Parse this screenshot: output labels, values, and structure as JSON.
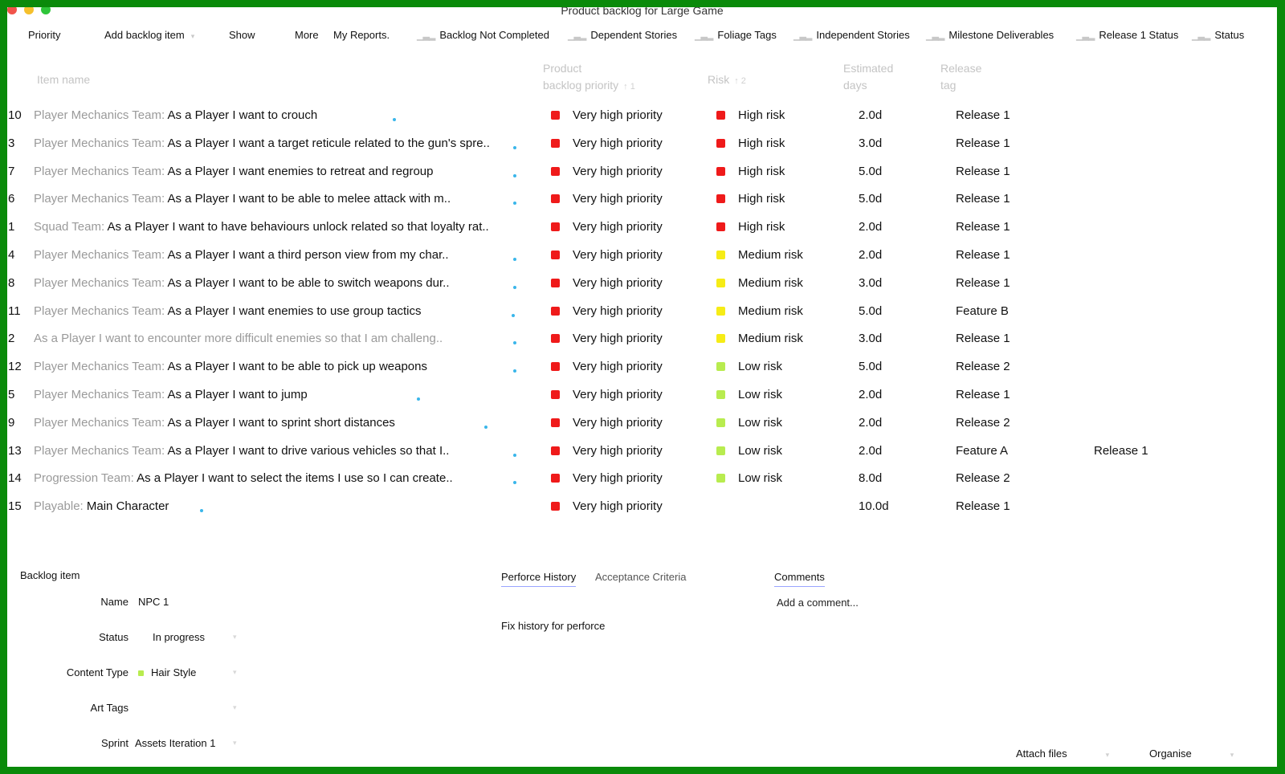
{
  "window": {
    "title": "Product backlog for Large Game"
  },
  "toolbar": {
    "priority": "Priority",
    "add_backlog_item": "Add backlog item",
    "show": "Show",
    "more": "More",
    "my_reports": "My Reports.",
    "reports": [
      "Backlog Not Completed",
      "Dependent Stories",
      "Foliage Tags",
      "Independent Stories",
      "Milestone Deliverables",
      "Release 1 Status",
      "Status"
    ]
  },
  "columns": {
    "item_name": "Item name",
    "priority_l1": "Product",
    "priority_l2": "backlog priority",
    "priority_sort": "↑ 1",
    "risk": "Risk",
    "risk_sort": "↑ 2",
    "est_l1": "Estimated",
    "est_l2": "days",
    "tag_l1": "Release",
    "tag_l2": "tag"
  },
  "colors": {
    "very_high_priority": "#ef1a1a",
    "high_risk": "#ef1a1a",
    "medium_risk": "#f6ec16",
    "low_risk": "#b8ec4f",
    "hair_style": "#b8ec4f",
    "window_border": "#0a8a0a"
  },
  "rows": [
    {
      "id": "10",
      "team": "Player Mechanics Team:",
      "story": " As a Player I want to crouch",
      "priority": "Very high priority",
      "risk": "High risk",
      "risk_level": "high",
      "est": "2.0d",
      "tag": "Release 1",
      "extra": ""
    },
    {
      "id": "3",
      "team": "Player Mechanics Team:",
      "story": " As a Player I want a target reticule related to the gun's spre..",
      "priority": "Very high priority",
      "risk": "High risk",
      "risk_level": "high",
      "est": "3.0d",
      "tag": "Release 1",
      "extra": ""
    },
    {
      "id": "7",
      "team": "Player Mechanics Team:",
      "story": " As a Player I want enemies to retreat and regroup",
      "priority": "Very high priority",
      "risk": "High risk",
      "risk_level": "high",
      "est": "5.0d",
      "tag": "Release 1",
      "extra": ""
    },
    {
      "id": "6",
      "team": "Player Mechanics Team:",
      "story": " As a Player I want to be able to melee attack with m..",
      "priority": "Very high priority",
      "risk": "High risk",
      "risk_level": "high",
      "est": "5.0d",
      "tag": "Release 1",
      "extra": ""
    },
    {
      "id": "1",
      "team": "Squad Team:",
      "story": " As a Player I want to have behaviours unlock related so that loyalty rat..",
      "priority": "Very high priority",
      "risk": "High risk",
      "risk_level": "high",
      "est": "2.0d",
      "tag": "Release 1",
      "extra": ""
    },
    {
      "id": "4",
      "team": "Player Mechanics Team:",
      "story": " As a Player I want a third person view from my char..",
      "priority": "Very high priority",
      "risk": "Medium risk",
      "risk_level": "medium",
      "est": "2.0d",
      "tag": "Release 1",
      "extra": ""
    },
    {
      "id": "8",
      "team": "Player Mechanics Team:",
      "story": " As a Player I want to be able to switch weapons dur..",
      "priority": "Very high priority",
      "risk": "Medium risk",
      "risk_level": "medium",
      "est": "3.0d",
      "tag": "Release 1",
      "extra": ""
    },
    {
      "id": "11",
      "team": "Player Mechanics Team:",
      "story": " As a Player I want enemies to use group tactics",
      "priority": "Very high priority",
      "risk": "Medium risk",
      "risk_level": "medium",
      "est": "5.0d",
      "tag": "Feature B",
      "extra": ""
    },
    {
      "id": "2",
      "team": "As a Player I want to encounter more difficult enemies so that I am challeng..",
      "story": "",
      "priority": "Very high priority",
      "risk": "Medium risk",
      "risk_level": "medium",
      "est": "3.0d",
      "tag": "Release 1",
      "extra": ""
    },
    {
      "id": "12",
      "team": "Player Mechanics Team:",
      "story": " As a Player I want to be able to pick up weapons",
      "priority": "Very high priority",
      "risk": "Low risk",
      "risk_level": "low",
      "est": "5.0d",
      "tag": "Release 2",
      "extra": ""
    },
    {
      "id": "5",
      "team": "Player Mechanics Team:",
      "story": " As a Player I want to jump",
      "priority": "Very high priority",
      "risk": "Low risk",
      "risk_level": "low",
      "est": "2.0d",
      "tag": "Release 1",
      "extra": ""
    },
    {
      "id": "9",
      "team": "Player Mechanics Team:",
      "story": " As a Player I want to sprint short distances",
      "priority": "Very high priority",
      "risk": "Low risk",
      "risk_level": "low",
      "est": "2.0d",
      "tag": "Release 2",
      "extra": ""
    },
    {
      "id": "13",
      "team": "Player Mechanics Team:",
      "story": " As a Player I want to drive various vehicles so that I..",
      "priority": "Very high priority",
      "risk": "Low risk",
      "risk_level": "low",
      "est": "2.0d",
      "tag": "Feature A",
      "extra": "Release 1"
    },
    {
      "id": "14",
      "team": "Progression Team:",
      "story": " As a Player I want to select the items I use so I can create..",
      "priority": "Very high priority",
      "risk": "Low risk",
      "risk_level": "low",
      "est": "8.0d",
      "tag": "Release 2",
      "extra": ""
    },
    {
      "id": "15",
      "team": "Playable:",
      "story": " Main Character",
      "priority": "Very high priority",
      "risk": "",
      "risk_level": "none",
      "est": "10.0d",
      "tag": "Release 1",
      "extra": ""
    }
  ],
  "detail": {
    "title": "Backlog item",
    "name_label": "Name",
    "name_value": "NPC 1",
    "status_label": "Status",
    "status_value": "In progress",
    "content_type_label": "Content Type",
    "content_type_value": "Hair Style",
    "art_tags_label": "Art Tags",
    "art_tags_value": "",
    "sprint_label": "Sprint",
    "sprint_value": "Assets Iteration 1"
  },
  "tabs": {
    "perforce": "Perforce History",
    "acceptance": "Acceptance Criteria",
    "comments": "Comments"
  },
  "perforce": {
    "text": "Fix history for perforce"
  },
  "comments": {
    "placeholder": "Add a comment..."
  },
  "bottom": {
    "attach": "Attach files",
    "organise": "Organise"
  }
}
